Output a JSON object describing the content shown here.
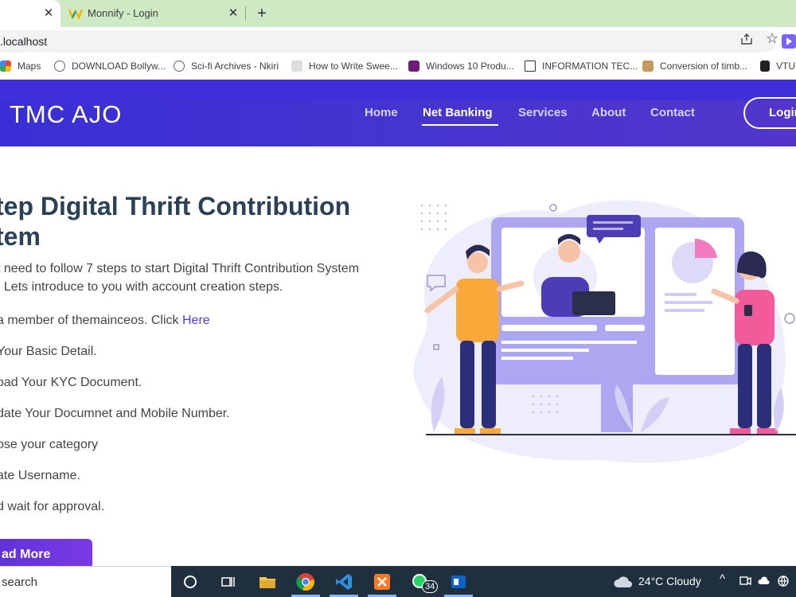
{
  "browser": {
    "active_tab_close": "✕",
    "second_tab": {
      "title": "Monnify - Login",
      "close": "✕"
    },
    "new_tab": "+",
    "url": ".localhost",
    "bookmarks": [
      {
        "label": "Maps",
        "color": "#34a853"
      },
      {
        "label": "DOWNLOAD Bollyw...",
        "color": "#777777"
      },
      {
        "label": "Sci-fi Archives - Nkiri",
        "color": "#777777"
      },
      {
        "label": "How to Write Swee...",
        "color": "#444444"
      },
      {
        "label": "Windows 10 Produ...",
        "color": "#6b1f7a"
      },
      {
        "label": "INFORMATION TEC...",
        "color": "#333333"
      },
      {
        "label": "Conversion of timb...",
        "color": "#aa7733"
      },
      {
        "label": "VTU",
        "color": "#222222"
      }
    ]
  },
  "site": {
    "brand": "TMC AJO",
    "nav": [
      {
        "label": "Home",
        "active": false
      },
      {
        "label": "Net Banking",
        "active": true
      },
      {
        "label": "Services",
        "active": false
      },
      {
        "label": "About",
        "active": false
      },
      {
        "label": "Contact",
        "active": false
      }
    ],
    "login_label": "Login",
    "accent": "#4534cf"
  },
  "hero": {
    "title_line1": "tep Digital Thrift Contribution",
    "title_line2": "tem",
    "intro_line1": "t need to follow 7 steps to start Digital Thrift Contribution System",
    "intro_line2": ". Lets introduce to you with account creation steps.",
    "steps": [
      {
        "text": "a member of themainceos. Click ",
        "link": "Here"
      },
      {
        "text": "Your Basic Detail."
      },
      {
        "text": "oad Your KYC Document."
      },
      {
        "text": "date Your Documnet and Mobile Number."
      },
      {
        "text": "ose your category"
      },
      {
        "text": "ate Username."
      },
      {
        "text": "d wait for approval."
      }
    ],
    "read_more": "ad More"
  },
  "taskbar": {
    "search": "search",
    "whatsapp_badge": "34",
    "weather": "24°C  Cloudy",
    "tray_caret": "^"
  }
}
